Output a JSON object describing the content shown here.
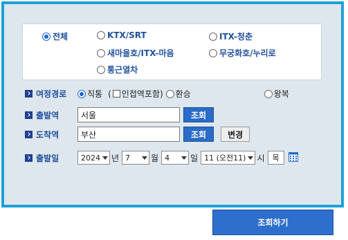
{
  "train_types": [
    {
      "label": "전체",
      "selected": true
    },
    {
      "label": "KTX/SRT",
      "selected": false
    },
    {
      "label": "ITX-청춘",
      "selected": false
    },
    {
      "label": "새마을호/ITX-마음",
      "selected": false
    },
    {
      "label": "무궁화호/누리로",
      "selected": false
    },
    {
      "label": "통근열차",
      "selected": false
    }
  ],
  "route": {
    "label": "여정경로",
    "direct": "직통",
    "include_transfer_prefix": "(",
    "include_transfer": "인접역포함)",
    "transfer": "환승",
    "roundtrip": "왕복"
  },
  "departure": {
    "label": "출발역",
    "value": "서울",
    "button": "조회"
  },
  "arrival": {
    "label": "도착역",
    "value": "부산",
    "button": "조회",
    "swap": "변경"
  },
  "date": {
    "label": "출발일",
    "year": "2024",
    "year_unit": "년",
    "month": "7",
    "month_unit": "월",
    "day": "4",
    "day_unit": "일",
    "hour": "11 (오전11)",
    "hour_unit": "시",
    "weekday": "목"
  },
  "submit": "조회하기",
  "colors": {
    "frame": "#1da1d8",
    "panel": "#dfe7ee",
    "accent": "#1f4f9d",
    "button": "#2a6cc7"
  },
  "icons": {
    "label_marker": "arrow-right-icon",
    "calendar": "calendar-icon"
  }
}
